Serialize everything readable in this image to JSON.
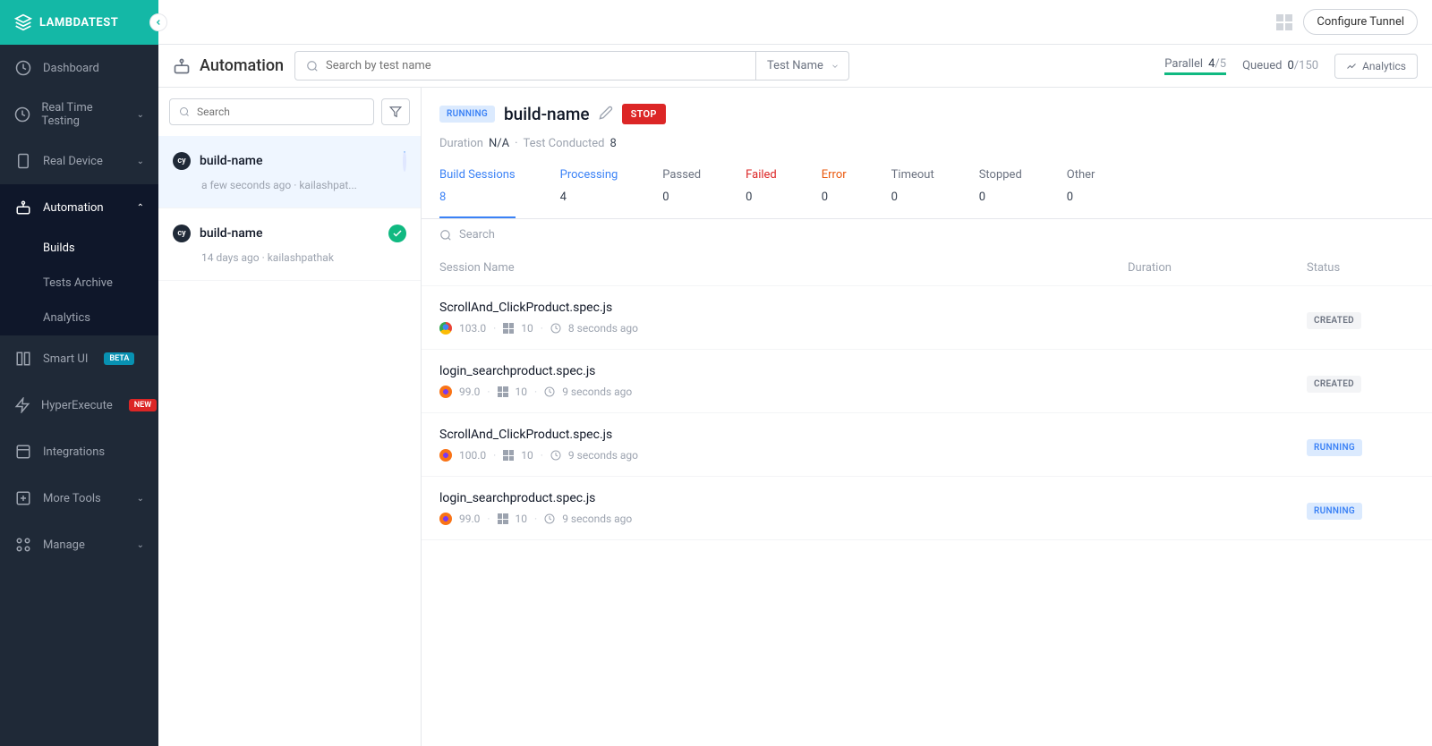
{
  "brand": "LAMBDATEST",
  "topbar": {
    "configure": "Configure Tunnel"
  },
  "nav": {
    "dashboard": "Dashboard",
    "realtime": "Real Time Testing",
    "realdevice": "Real Device",
    "automation": "Automation",
    "automation_sub": {
      "builds": "Builds",
      "archive": "Tests Archive",
      "analytics": "Analytics"
    },
    "smartui": "Smart UI",
    "smartui_badge": "BETA",
    "hyperexecute": "HyperExecute",
    "hyperexecute_badge": "NEW",
    "integrations": "Integrations",
    "moretools": "More Tools",
    "manage": "Manage"
  },
  "header": {
    "title": "Automation",
    "search_ph": "Search by test name",
    "select": "Test Name",
    "parallel_label": "Parallel",
    "parallel_val": "4",
    "parallel_max": "/5",
    "queued_label": "Queued",
    "queued_val": "0",
    "queued_max": "/150",
    "analytics": "Analytics"
  },
  "buildlist": {
    "search_ph": "Search",
    "items": [
      {
        "name": "build-name",
        "meta": "a few seconds ago  ·  kailashpat..."
      },
      {
        "name": "build-name",
        "meta": "14 days ago  ·  kailashpathak"
      }
    ]
  },
  "detail": {
    "running": "RUNNING",
    "name": "build-name",
    "stop": "STOP",
    "duration_label": "Duration",
    "duration_val": "N/A",
    "conducted_label": "Test Conducted",
    "conducted_val": "8",
    "session_search_ph": "Search",
    "cols": {
      "name": "Session Name",
      "duration": "Duration",
      "status": "Status"
    }
  },
  "tabs": [
    {
      "label": "Build Sessions",
      "count": "8"
    },
    {
      "label": "Processing",
      "count": "4"
    },
    {
      "label": "Passed",
      "count": "0"
    },
    {
      "label": "Failed",
      "count": "0"
    },
    {
      "label": "Error",
      "count": "0"
    },
    {
      "label": "Timeout",
      "count": "0"
    },
    {
      "label": "Stopped",
      "count": "0"
    },
    {
      "label": "Other",
      "count": "0"
    }
  ],
  "sessions": [
    {
      "name": "ScrollAnd_ClickProduct.spec.js",
      "browser": "chrome",
      "bver": "103.0",
      "os": "10",
      "time": "8 seconds ago",
      "status": "CREATED",
      "scls": "created"
    },
    {
      "name": "login_searchproduct.spec.js",
      "browser": "firefox",
      "bver": "99.0",
      "os": "10",
      "time": "9 seconds ago",
      "status": "CREATED",
      "scls": "created"
    },
    {
      "name": "ScrollAnd_ClickProduct.spec.js",
      "browser": "firefox",
      "bver": "100.0",
      "os": "10",
      "time": "9 seconds ago",
      "status": "RUNNING",
      "scls": "running"
    },
    {
      "name": "login_searchproduct.spec.js",
      "browser": "firefox",
      "bver": "99.0",
      "os": "10",
      "time": "9 seconds ago",
      "status": "RUNNING",
      "scls": "running"
    }
  ]
}
